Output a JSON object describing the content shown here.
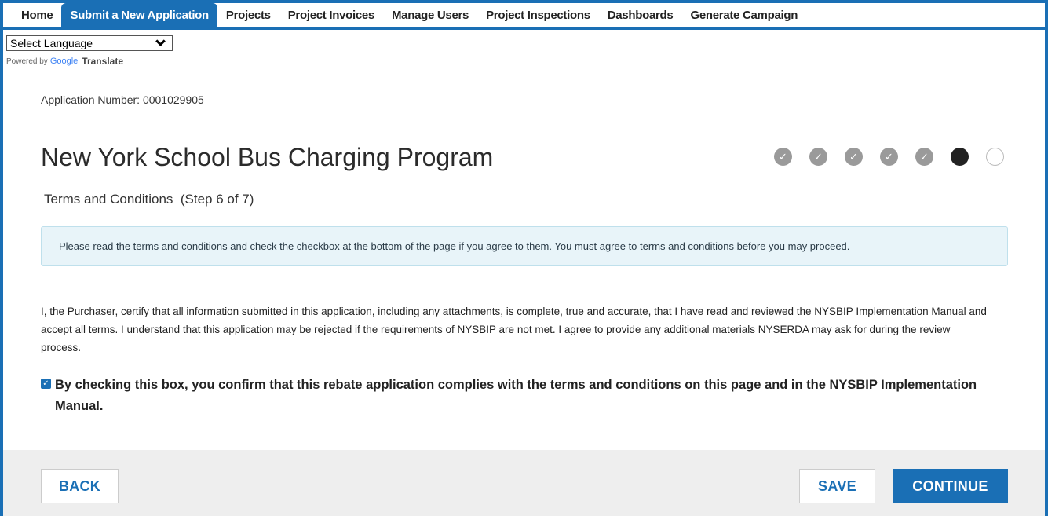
{
  "nav": {
    "items": [
      {
        "label": "Home",
        "active": false
      },
      {
        "label": "Submit a New Application",
        "active": true
      },
      {
        "label": "Projects",
        "active": false
      },
      {
        "label": "Project Invoices",
        "active": false
      },
      {
        "label": "Manage Users",
        "active": false
      },
      {
        "label": "Project Inspections",
        "active": false
      },
      {
        "label": "Dashboards",
        "active": false
      },
      {
        "label": "Generate Campaign",
        "active": false
      }
    ]
  },
  "translate": {
    "select_value": "Select Language",
    "powered_by": "Powered by",
    "google": "Google",
    "translate": "Translate"
  },
  "application": {
    "number_label": "Application Number: 0001029905",
    "title": "New York School Bus Charging Program",
    "step_label": "Terms and Conditions  (Step 6 of 7)",
    "steps": [
      "complete",
      "complete",
      "complete",
      "complete",
      "complete",
      "current",
      "pending"
    ]
  },
  "notice": "Please read the terms and conditions and check the checkbox at the bottom of the page if you agree to them. You must agree to terms and conditions before you may proceed.",
  "terms_text": "I, the Purchaser, certify that all information submitted in this application, including any attachments, is complete, true and accurate, that I have read and reviewed the NYSBIP Implementation Manual and accept all terms. I understand that this application may be rejected if the requirements of NYSBIP are not met. I agree to provide any additional materials NYSERDA may ask for during the review process.",
  "agreement": {
    "checked": true,
    "label": "By checking this box, you confirm that this rebate application complies with the terms and conditions on this page and in the NYSBIP Implementation Manual."
  },
  "footer": {
    "back_label": "BACK",
    "save_label": "SAVE",
    "continue_label": "CONTINUE"
  },
  "colors": {
    "accent": "#1a6fb5",
    "notice_bg": "#e8f4f9",
    "step_complete": "#9a9a9a",
    "step_current": "#222222"
  }
}
